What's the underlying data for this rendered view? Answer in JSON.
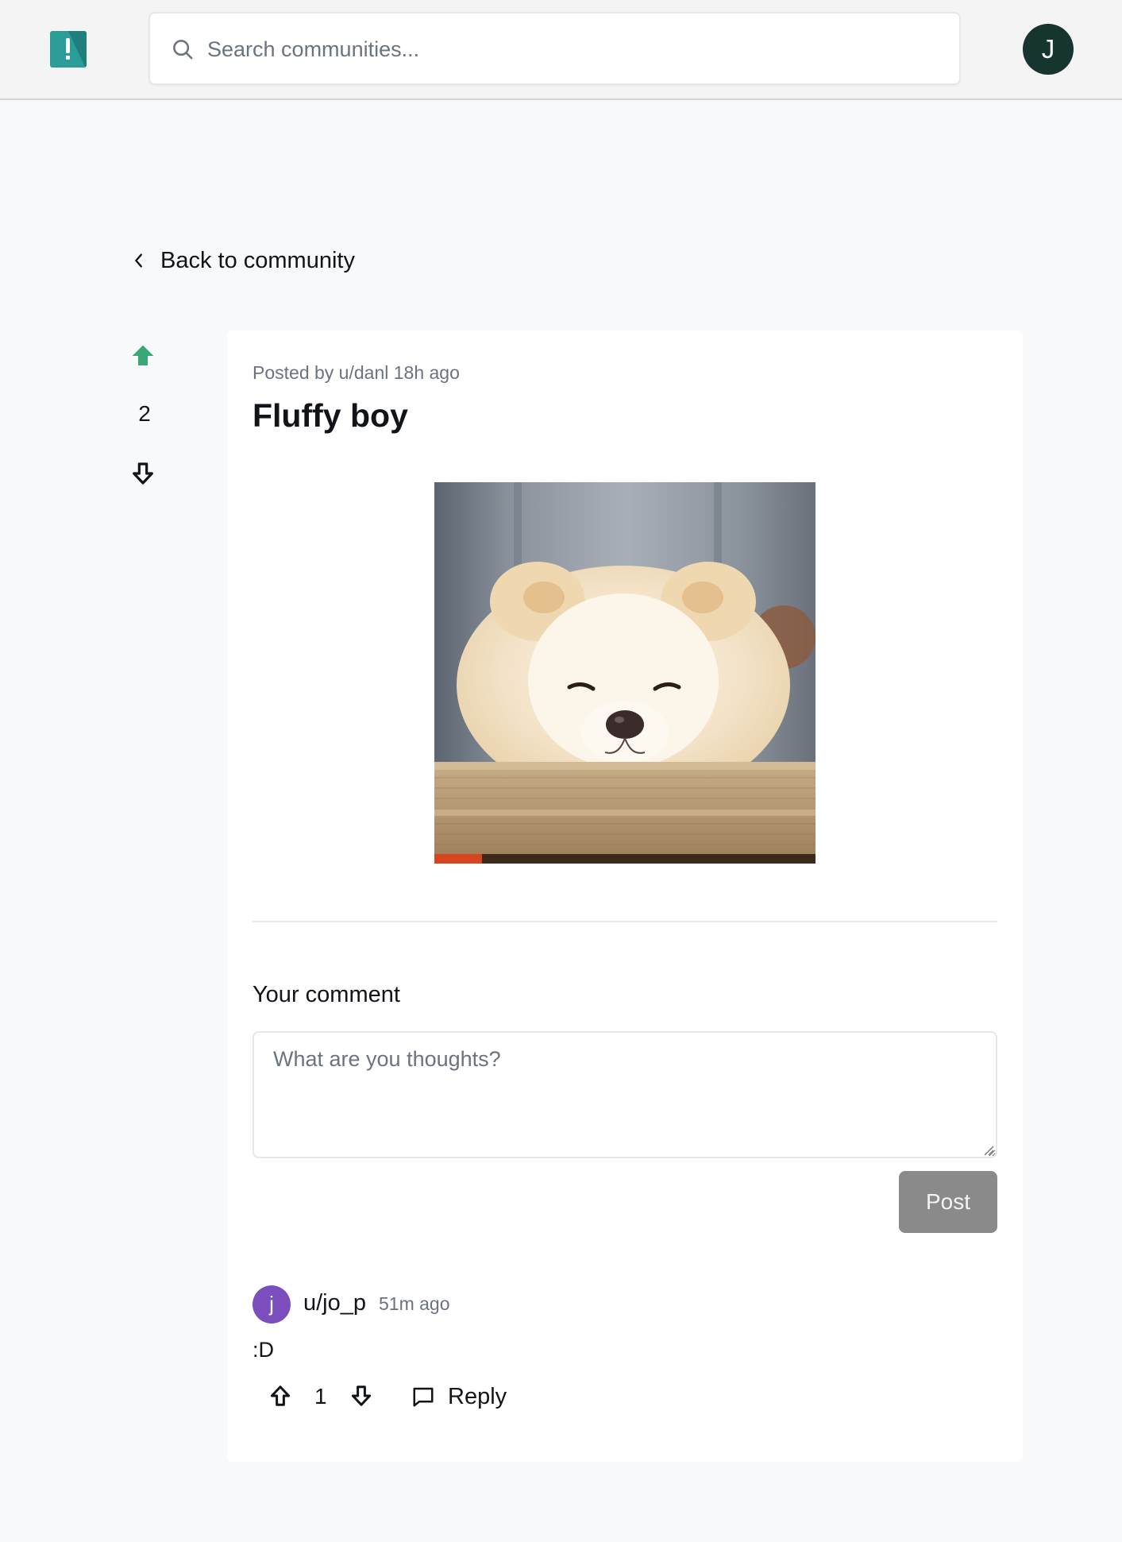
{
  "header": {
    "logo_icon": "app-logo-icon",
    "search": {
      "placeholder": "Search communities...",
      "icon": "search-icon"
    },
    "avatar_initial": "J"
  },
  "nav": {
    "back_label": "Back to community",
    "icon": "chevron-left-icon"
  },
  "post": {
    "meta": "Posted by u/danl 18h ago",
    "title": "Fluffy boy",
    "votes": "2",
    "upvoted": true,
    "image_alt": "Fluffy cream chow chow puppy resting on a burlap bed",
    "accent_color": "#3aa876"
  },
  "comment_form": {
    "label": "Your comment",
    "placeholder": "What are you thoughts?",
    "submit_label": "Post"
  },
  "comments": [
    {
      "avatar_initial": "j",
      "avatar_color": "#7c4dbc",
      "user": "u/jo_p",
      "time": "51m ago",
      "body": ":D",
      "votes": "1",
      "reply_label": "Reply"
    }
  ]
}
